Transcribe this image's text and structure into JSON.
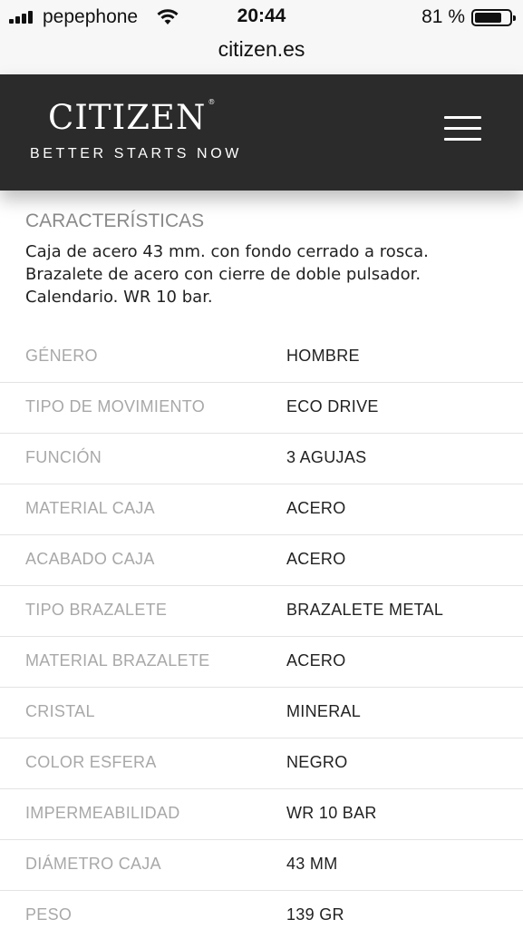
{
  "status_bar": {
    "carrier": "pepephone",
    "time": "20:44",
    "battery": "81 %",
    "battery_level": 0.81
  },
  "browser": {
    "url": "citizen.es"
  },
  "header": {
    "logo": "CITIZEN",
    "logo_mark": "®",
    "tagline": "BETTER STARTS NOW",
    "background_color": "#2b2b2b"
  },
  "section": {
    "title": "CARACTERÍSTICAS",
    "description_lines": [
      "Caja de acero 43 mm. con fondo cerrado a rosca.",
      "Brazalete de acero con cierre de doble pulsador.",
      "Calendario. WR 10 bar."
    ]
  },
  "specs": [
    {
      "label": "GÉNERO",
      "value": "HOMBRE"
    },
    {
      "label": "TIPO DE MOVIMIENTO",
      "value": "ECO DRIVE"
    },
    {
      "label": "FUNCIÓN",
      "value": "3 AGUJAS"
    },
    {
      "label": "MATERIAL CAJA",
      "value": "ACERO"
    },
    {
      "label": "ACABADO CAJA",
      "value": "ACERO"
    },
    {
      "label": "TIPO BRAZALETE",
      "value": "BRAZALETE METAL"
    },
    {
      "label": "MATERIAL BRAZALETE",
      "value": "ACERO"
    },
    {
      "label": "CRISTAL",
      "value": "MINERAL"
    },
    {
      "label": "COLOR ESFERA",
      "value": "NEGRO"
    },
    {
      "label": "IMPERMEABILIDAD",
      "value": "WR 10 BAR"
    },
    {
      "label": "DIÁMETRO CAJA",
      "value": "43 MM"
    },
    {
      "label": "PESO",
      "value": "139 GR"
    }
  ],
  "icons": {
    "signal": "cellular-signal-icon",
    "wifi": "wifi-icon",
    "battery": "battery-icon",
    "menu": "hamburger-menu-icon"
  }
}
